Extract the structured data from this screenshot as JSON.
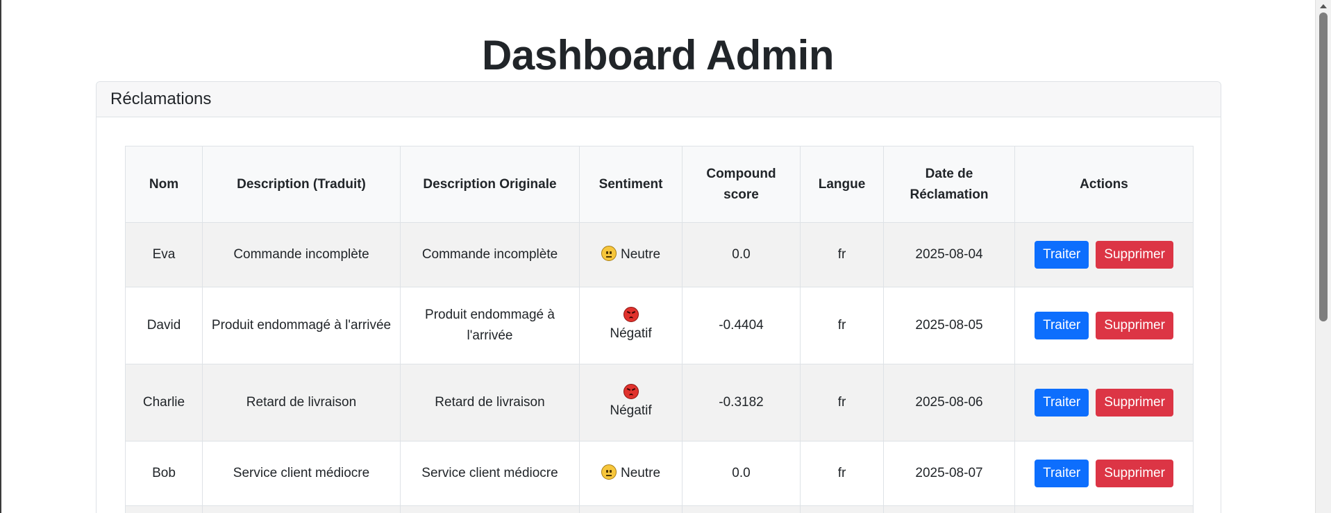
{
  "page": {
    "title": "Dashboard Admin"
  },
  "card": {
    "header": "Réclamations"
  },
  "table": {
    "columns": [
      "Nom",
      "Description (Traduit)",
      "Description Originale",
      "Sentiment",
      "Compound score",
      "Langue",
      "Date de Réclamation",
      "Actions"
    ],
    "rows": [
      {
        "nom": "Eva",
        "desc_traduit": "Commande incomplète",
        "desc_originale": "Commande incomplète",
        "sentiment": "Neutre",
        "sentiment_icon": "neutral-face-icon",
        "compound": "0.0",
        "langue": "fr",
        "date": "2025-08-04"
      },
      {
        "nom": "David",
        "desc_traduit": "Produit endommagé à l'arrivée",
        "desc_originale": "Produit endommagé à l'arrivée",
        "sentiment": "Négatif",
        "sentiment_icon": "angry-face-icon",
        "compound": "-0.4404",
        "langue": "fr",
        "date": "2025-08-05"
      },
      {
        "nom": "Charlie",
        "desc_traduit": "Retard de livraison",
        "desc_originale": "Retard de livraison",
        "sentiment": "Négatif",
        "sentiment_icon": "angry-face-icon",
        "compound": "-0.3182",
        "langue": "fr",
        "date": "2025-08-06"
      },
      {
        "nom": "Bob",
        "desc_traduit": "Service client médiocre",
        "desc_originale": "Service client médiocre",
        "sentiment": "Neutre",
        "sentiment_icon": "neutral-face-icon",
        "compound": "0.0",
        "langue": "fr",
        "date": "2025-08-07"
      }
    ],
    "actions": {
      "process_label": "Traiter",
      "delete_label": "Supprimer"
    }
  },
  "colors": {
    "primary": "#0d6efd",
    "danger": "#dc3545",
    "header_bg": "#f8f9fa",
    "stripe_bg": "#f2f2f2"
  }
}
